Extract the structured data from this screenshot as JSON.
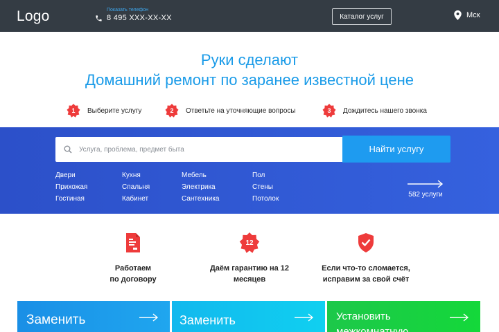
{
  "header": {
    "logo": "Logo",
    "phone_hint": "Показать телефон",
    "phone_number": "8 495 XXX-XX-XX",
    "catalog_button": "Каталог услуг",
    "city": "Мск"
  },
  "hero": {
    "title_line1": "Руки сделают",
    "title_line2": "Домашний ремонт по заранее известной цене"
  },
  "steps": [
    {
      "number": "1",
      "label": "Выберите услугу"
    },
    {
      "number": "2",
      "label": "Ответьте на уточняющие вопросы"
    },
    {
      "number": "3",
      "label": "Дождитесь нашего звонка"
    }
  ],
  "search": {
    "placeholder": "Услуга, проблема, предмет быта",
    "button": "Найти услугу",
    "categories": [
      [
        "Двери",
        "Прихожая",
        "Гостиная"
      ],
      [
        "Кухня",
        "Спальня",
        "Кабинет"
      ],
      [
        "Мебель",
        "Электрика",
        "Сантехника"
      ],
      [
        "Пол",
        "Стены",
        "Потолок"
      ]
    ],
    "services_count": "582 услуги"
  },
  "features": [
    {
      "icon": "contract-icon",
      "badge": "",
      "text": "Работаем\nпо договору"
    },
    {
      "icon": "guarantee-badge-icon",
      "badge": "12",
      "text": "Даём гарантию на 12\nмесяцев"
    },
    {
      "icon": "shield-check-icon",
      "badge": "",
      "text": "Если что-то сломается,\nисправим за свой счёт"
    }
  ],
  "cards": [
    {
      "title": "Заменить",
      "color_from": "#1a8fe6",
      "color_to": "#1fa6ef"
    },
    {
      "title": "Заменить",
      "color_from": "#12b8ee",
      "color_to": "#10d0f0"
    },
    {
      "title": "Установить межкомнатную",
      "color_from": "#1dc84a",
      "color_to": "#14d83a"
    }
  ],
  "colors": {
    "header_bg": "#343c44",
    "accent_blue": "#1a9be8",
    "band_blue": "#3561de",
    "button_blue": "#1e9bf0",
    "badge_red": "#ee3b3b"
  }
}
